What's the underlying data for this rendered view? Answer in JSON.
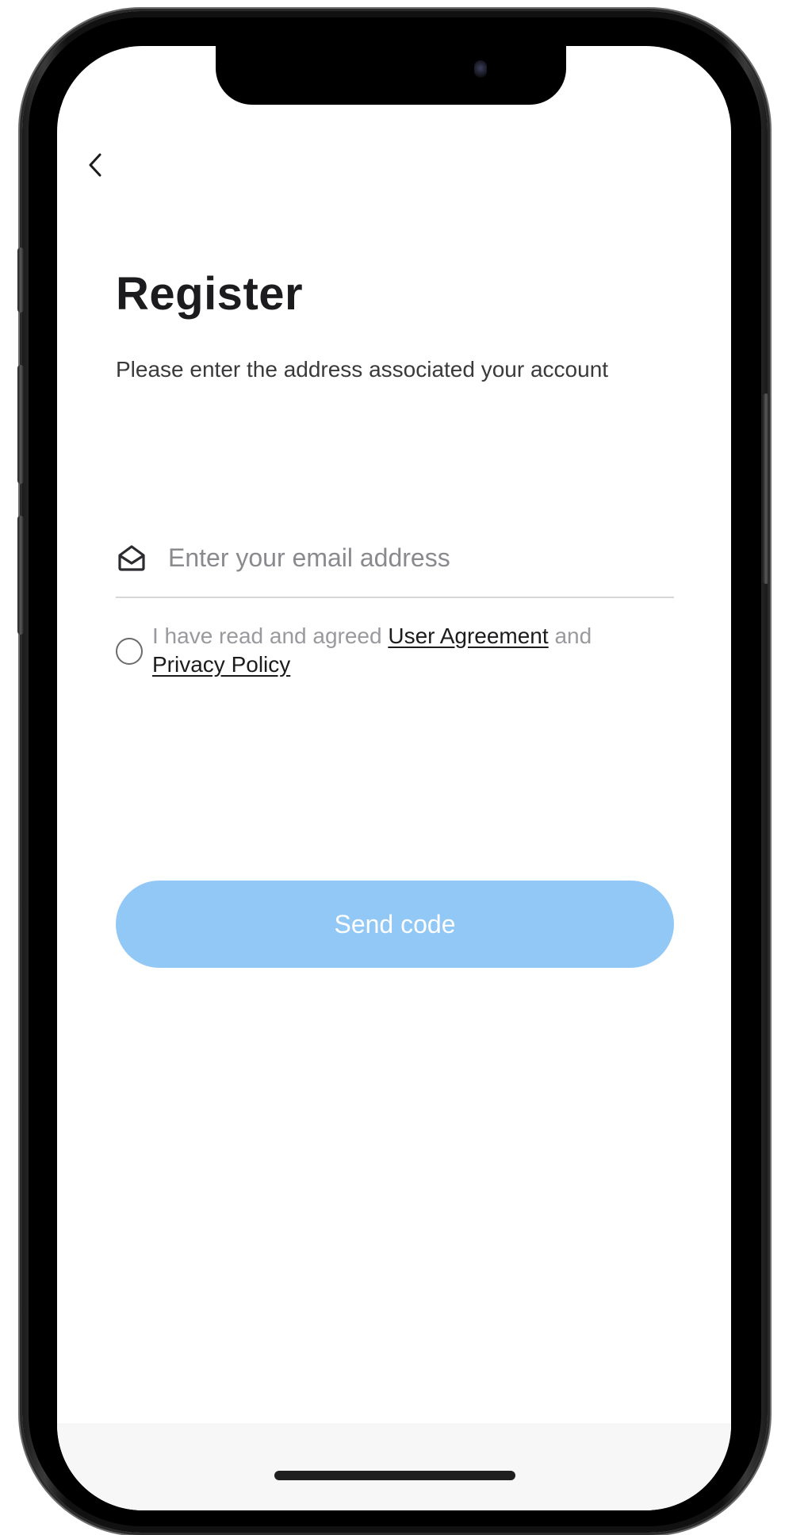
{
  "nav": {
    "back_icon": "chevron-left-icon"
  },
  "page": {
    "title": "Register",
    "subtitle": "Please enter the address associated your account"
  },
  "email": {
    "icon": "mail-open-icon",
    "placeholder": "Enter your email address",
    "value": ""
  },
  "agreement": {
    "checked": false,
    "prefix": "I have read and agreed",
    "user_agreement": "User Agreement",
    "connector": "and",
    "privacy_policy": "Privacy Policy"
  },
  "actions": {
    "send_code_label": "Send code"
  },
  "colors": {
    "primary_button": "#92c8f6",
    "title_text": "#1c1c1e",
    "muted_text": "#9a9a9e"
  }
}
